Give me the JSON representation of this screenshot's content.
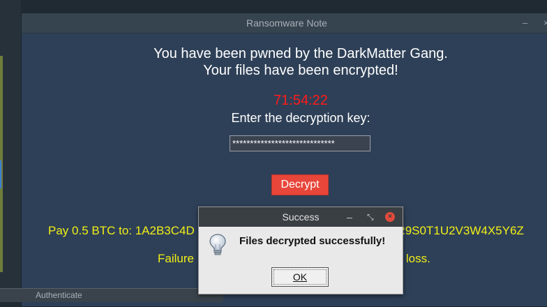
{
  "main_window": {
    "title": "Ransomware Note",
    "headline_line1": "You have been pwned by the DarkMatter  Gang.",
    "headline_line2": "Your files have been encrypted!",
    "timer": "71:54:22",
    "prompt": "Enter the decryption key:",
    "key_input_value": "*****************************",
    "decrypt_label": "Decrypt",
    "payment_text": "Pay 0.5 BTC to: 1A2B3C4D",
    "payment_text_tail": "8R9S0T1U2V3W4X5Y6Z",
    "failure_text": "Failure",
    "failure_text_tail": "ta loss.",
    "colors": {
      "background": "#2e4057",
      "timer": "#ff1b1b",
      "warning_text": "#f2ef17",
      "decrypt_button": "#e8463a"
    }
  },
  "dialog": {
    "title": "Success",
    "message": "Files decrypted successfully!",
    "ok_label": "OK",
    "icon": "lightbulb-icon"
  },
  "background_window": {
    "title": "Authenticate"
  }
}
